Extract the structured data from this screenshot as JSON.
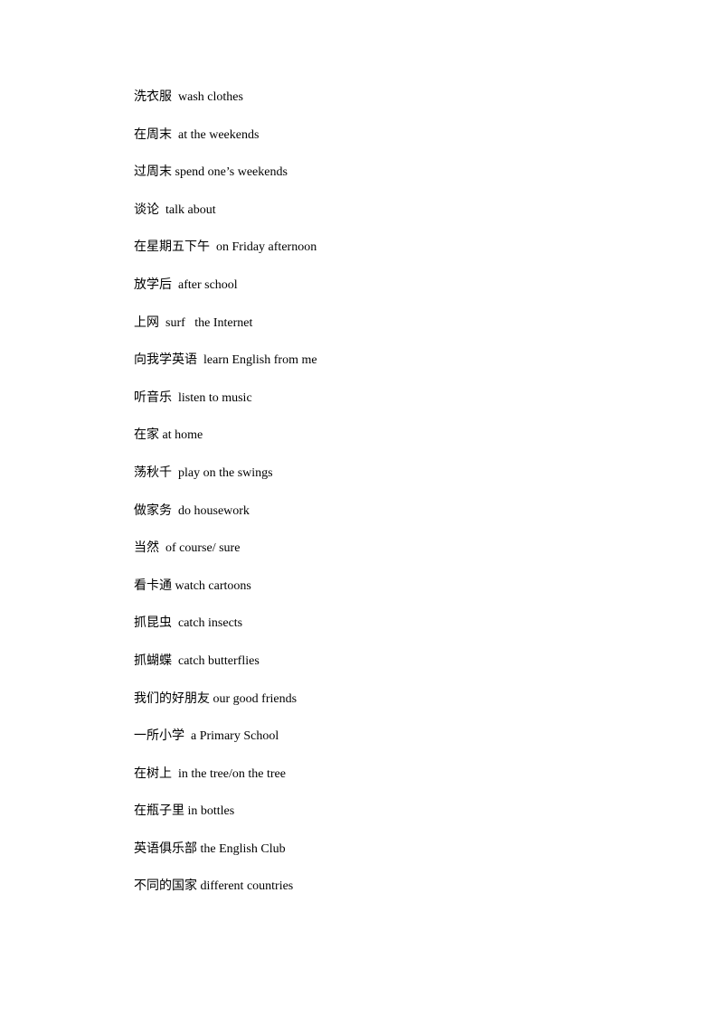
{
  "document": {
    "entries": [
      {
        "cn": "洗衣服",
        "en": "wash clothes",
        "sep": "  "
      },
      {
        "cn": "在周末",
        "en": "at the weekends",
        "sep": "  "
      },
      {
        "cn": "过周末",
        "en": "spend one’s weekends",
        "sep": " "
      },
      {
        "cn": "谈论",
        "en": "talk about",
        "sep": "  "
      },
      {
        "cn": "在星期五下午",
        "en": "on Friday afternoon",
        "sep": "  "
      },
      {
        "cn": "放学后",
        "en": "after school",
        "sep": "  "
      },
      {
        "cn": "上网",
        "en": "surf   the Internet",
        "sep": "  "
      },
      {
        "cn": "向我学英语",
        "en": "learn English from me",
        "sep": "  "
      },
      {
        "cn": "听音乐",
        "en": "listen to music",
        "sep": "  "
      },
      {
        "cn": "在家",
        "en": "at home",
        "sep": " "
      },
      {
        "cn": "荡秋千",
        "en": "play on the swings",
        "sep": "  "
      },
      {
        "cn": "做家务",
        "en": "do housework",
        "sep": "  "
      },
      {
        "cn": "当然",
        "en": "of course/ sure",
        "sep": "  "
      },
      {
        "cn": "看卡通",
        "en": "watch cartoons",
        "sep": " "
      },
      {
        "cn": "抓昆虫",
        "en": "catch insects",
        "sep": "  "
      },
      {
        "cn": "抓蝴蝶",
        "en": "catch butterflies",
        "sep": "  "
      },
      {
        "cn": "我们的好朋友",
        "en": "our good friends",
        "sep": " "
      },
      {
        "cn": "一所小学",
        "en": "a Primary School",
        "sep": "  "
      },
      {
        "cn": "在树上",
        "en": "in the tree/on the tree",
        "sep": "  "
      },
      {
        "cn": "在瓶子里",
        "en": "in bottles",
        "sep": " "
      },
      {
        "cn": "英语俱乐部",
        "en": "the English Club",
        "sep": " "
      },
      {
        "cn": "不同的国家",
        "en": "different countries",
        "sep": " "
      }
    ]
  }
}
